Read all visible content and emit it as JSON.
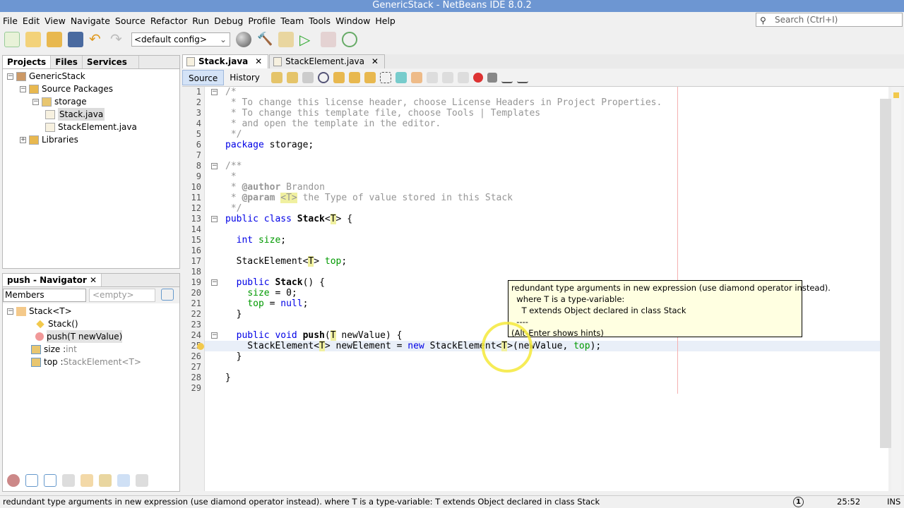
{
  "window": {
    "title": "GenericStack - NetBeans IDE 8.0.2"
  },
  "menu": [
    "File",
    "Edit",
    "View",
    "Navigate",
    "Source",
    "Refactor",
    "Run",
    "Debug",
    "Profile",
    "Team",
    "Tools",
    "Window",
    "Help"
  ],
  "search": {
    "placeholder": "Search (Ctrl+I)",
    "icon": "magnifier-icon"
  },
  "toolbar": {
    "config": "<default config>"
  },
  "projects_panel": {
    "tabs": [
      "Projects",
      "Files",
      "Services"
    ],
    "active": "Projects",
    "tree": [
      {
        "label": "GenericStack",
        "level": 0
      },
      {
        "label": "Source Packages",
        "level": 1
      },
      {
        "label": "storage",
        "level": 2
      },
      {
        "label": "Stack.java",
        "level": 3,
        "selected": true
      },
      {
        "label": "StackElement.java",
        "level": 3
      },
      {
        "label": "Libraries",
        "level": 1
      }
    ]
  },
  "navigator": {
    "title": "push - Navigator",
    "filter": "Members",
    "filter2": "<empty>",
    "root": "Stack<T>",
    "members": [
      {
        "name": "Stack()",
        "type": "",
        "kind": "constructor"
      },
      {
        "name": "push(T newValue)",
        "type": "",
        "kind": "method",
        "selected": true
      },
      {
        "name": "size : ",
        "type": "int",
        "kind": "field"
      },
      {
        "name": "top : ",
        "type": "StackElement<T>",
        "kind": "field"
      }
    ]
  },
  "editor": {
    "tabs": [
      "Stack.java",
      "StackElement.java"
    ],
    "active": "Stack.java",
    "view_tabs": [
      "Source",
      "History"
    ],
    "lines": [
      [
        [
          "/*",
          "cm"
        ]
      ],
      [
        [
          " * To change this license header, choose License Headers in Project Properties.",
          "cm"
        ]
      ],
      [
        [
          " * To change this template file, choose Tools | Templates",
          "cm"
        ]
      ],
      [
        [
          " * and open the template in the editor.",
          "cm"
        ]
      ],
      [
        [
          " */",
          "cm"
        ]
      ],
      [
        [
          "package",
          "kw"
        ],
        [
          " storage;",
          "nm"
        ]
      ],
      [],
      [
        [
          "/**",
          "cm"
        ]
      ],
      [
        [
          " *",
          "cm"
        ]
      ],
      [
        [
          " * ",
          "cm"
        ],
        [
          "@author",
          "tg"
        ],
        [
          " Brandon",
          "cm"
        ]
      ],
      [
        [
          " * ",
          "cm"
        ],
        [
          "@param",
          "tg"
        ],
        [
          " ",
          "cm"
        ],
        [
          "<T>",
          "cm tp"
        ],
        [
          " the Type of value stored in this Stack",
          "cm"
        ]
      ],
      [
        [
          " */",
          "cm"
        ]
      ],
      [
        [
          "public class",
          "kw"
        ],
        [
          " ",
          "nm"
        ],
        [
          "Stack",
          "nm bold"
        ],
        [
          "<",
          "nm"
        ],
        [
          "T",
          "nm tp"
        ],
        [
          "> {",
          "nm"
        ]
      ],
      [],
      [
        [
          "  ",
          "nm"
        ],
        [
          "int",
          "kw"
        ],
        [
          " ",
          "nm"
        ],
        [
          "size",
          "fld"
        ],
        [
          ";",
          "nm"
        ]
      ],
      [],
      [
        [
          "  StackElement<",
          "nm"
        ],
        [
          "T",
          "nm tp"
        ],
        [
          "> ",
          "nm"
        ],
        [
          "top",
          "fld"
        ],
        [
          ";",
          "nm"
        ]
      ],
      [],
      [
        [
          "  ",
          "nm"
        ],
        [
          "public",
          "kw"
        ],
        [
          " ",
          "nm"
        ],
        [
          "Stack",
          "nm bold"
        ],
        [
          "() {",
          "nm"
        ]
      ],
      [
        [
          "    ",
          "nm"
        ],
        [
          "size",
          "fld"
        ],
        [
          " = 0;",
          "nm"
        ]
      ],
      [
        [
          "    ",
          "nm"
        ],
        [
          "top",
          "fld"
        ],
        [
          " = ",
          "nm"
        ],
        [
          "null",
          "kw"
        ],
        [
          ";",
          "nm"
        ]
      ],
      [
        [
          "  }",
          "nm"
        ]
      ],
      [],
      [
        [
          "  ",
          "nm"
        ],
        [
          "public void",
          "kw"
        ],
        [
          " ",
          "nm"
        ],
        [
          "push",
          "nm bold"
        ],
        [
          "(",
          "nm"
        ],
        [
          "T",
          "nm tp"
        ],
        [
          " newValue) {",
          "nm"
        ]
      ],
      [
        [
          "    StackElement<",
          "nm"
        ],
        [
          "T",
          "nm tp"
        ],
        [
          "> newElement = ",
          "nm"
        ],
        [
          "new",
          "kw"
        ],
        [
          " StackElement<",
          "nm"
        ],
        [
          "T",
          "nm tp"
        ],
        [
          ">(newValue, ",
          "nm"
        ],
        [
          "top",
          "fld"
        ],
        [
          ");",
          "nm"
        ]
      ],
      [
        [
          "  }",
          "nm"
        ]
      ],
      [],
      [
        [
          "}",
          "nm"
        ]
      ],
      []
    ],
    "tooltip": [
      "redundant type arguments in new expression (use diamond operator instead).",
      "  where T is a type-variable:",
      "    T extends Object declared in class Stack",
      "  ----",
      "(Alt-Enter shows hints)"
    ]
  },
  "status": {
    "message": "redundant type arguments in new expression (use diamond operator instead).   where T is a type-variable:    T extends Object declared in class Stack",
    "notifications": "1",
    "position": "25:52",
    "mode": "INS"
  }
}
